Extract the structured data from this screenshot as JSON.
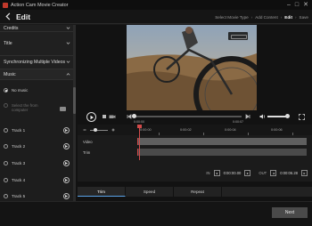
{
  "window": {
    "title": "Action Cam Movie Creator"
  },
  "header": {
    "title": "Edit",
    "steps": [
      "Select Movie Type",
      "Add Content",
      "Edit",
      "Save"
    ],
    "active_step": "Edit"
  },
  "sidebar": {
    "sections": [
      {
        "label": "Credits",
        "expanded": false
      },
      {
        "label": "Title",
        "expanded": false
      },
      {
        "label": "Synchronizing Multiple Videos",
        "expanded": false
      },
      {
        "label": "Music",
        "expanded": true
      }
    ],
    "music": {
      "no_music": "No music",
      "select_line1": "Select the from",
      "select_line2": "computer",
      "tracks": [
        "Track 1",
        "Track 2",
        "Track 3",
        "Track 4",
        "Track 5"
      ]
    }
  },
  "player": {
    "time_start": "0:00:00",
    "time_end": "0:00:07",
    "progress": 0.0
  },
  "timeline": {
    "ruler": [
      "0:00:00",
      "0:00:02",
      "0:00:04",
      "0:00:06"
    ],
    "rows": [
      "Video",
      "Trim"
    ],
    "in_label": "IN",
    "in_time": "0:00:00.00",
    "out_label": "OUT",
    "out_time": "0:00:06.28"
  },
  "tabs": [
    "Trim",
    "Speed",
    "Repeat"
  ],
  "active_tab": "Trim",
  "footer": {
    "next": "Next"
  },
  "colors": {
    "accent": "#5aa3e8",
    "playhead": "#d24a4a"
  }
}
